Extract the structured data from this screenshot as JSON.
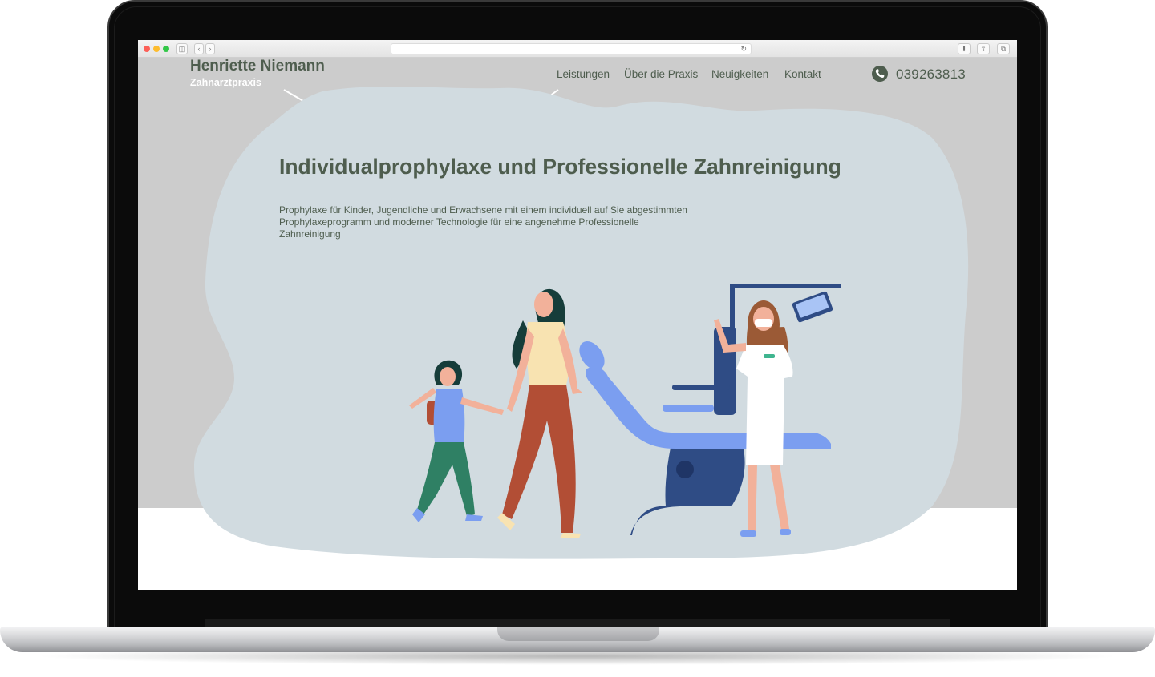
{
  "browser": {
    "url": "",
    "controls": {
      "sidebar_icon": "sidebar-icon",
      "back_icon": "chevron-left-icon",
      "forward_icon": "chevron-right-icon",
      "reload_icon": "reload-icon",
      "download_icon": "download-icon",
      "share_icon": "share-icon",
      "tabs_icon": "tabs-icon"
    }
  },
  "header": {
    "brand_name": "Henriette Niemann",
    "brand_sub": "Zahnarztpraxis",
    "nav": [
      {
        "label": "Leistungen"
      },
      {
        "label": "Über die Praxis"
      },
      {
        "label": "Neuigkeiten"
      },
      {
        "label": "Kontakt"
      }
    ],
    "phone": "039263813",
    "phone_icon": "phone-icon"
  },
  "hero": {
    "title": "Individualprophylaxe und Professionelle Zahnreinigung",
    "text": "Prophylaxe für Kinder, Jugendliche und Erwachsene mit einem individuell auf Sie abgestimmten Prophylaxeprogramm und moderner Technologie für eine angenehme Professionelle Zahnreinigung",
    "illustration": "family-at-dentist-illustration"
  },
  "colors": {
    "text": "#4e5d4e",
    "page_bg": "#cccccc",
    "blob": "#d1dbe0",
    "chair": "#7b9ef0",
    "chair_dark": "#2f4c85"
  }
}
